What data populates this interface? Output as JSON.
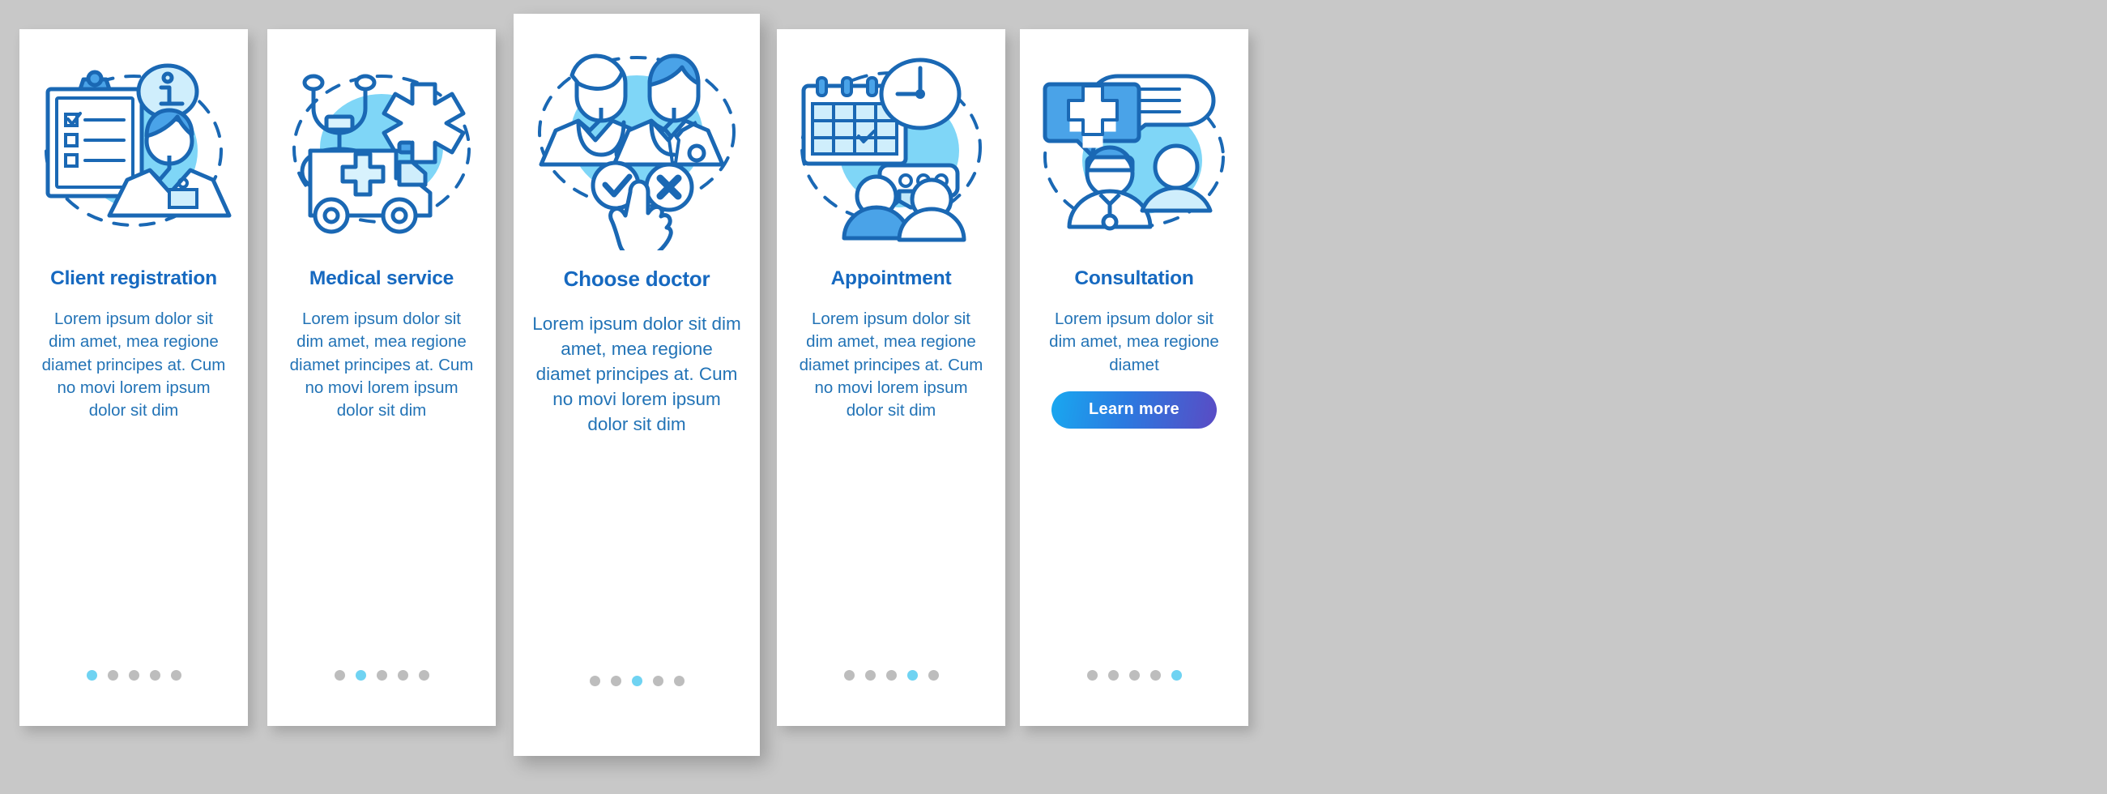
{
  "page": {
    "background_color": "#c8c8c8",
    "card_background": "#ffffff",
    "title_color": "#1669c0",
    "body_color": "#2273b6",
    "dot_active_color": "#6fd3f2",
    "dot_inactive_color": "#bdbdbd",
    "accent_light": "#7fd6f7",
    "accent_mid": "#4aa3e8",
    "accent_stroke": "#1a68b4"
  },
  "screens": [
    {
      "id": "client-registration",
      "title": "Client registration",
      "body": "Lorem ipsum dolor sit dim amet, mea regione diamet principes at. Cum no movi lorem ipsum dolor sit dim",
      "icon": "clipboard-checklist-person-info-icon",
      "dots": {
        "count": 5,
        "active_index": 0
      },
      "button": null
    },
    {
      "id": "medical-service",
      "title": "Medical service",
      "body": "Lorem ipsum dolor sit dim amet, mea regione diamet principes at. Cum no movi lorem ipsum dolor sit dim",
      "icon": "ambulance-stethoscope-star-of-life-icon",
      "dots": {
        "count": 5,
        "active_index": 1
      },
      "button": null
    },
    {
      "id": "choose-doctor",
      "title": "Choose doctor",
      "body": "Lorem ipsum dolor sit dim amet, mea regione diamet principes at. Cum no movi lorem ipsum dolor sit dim",
      "icon": "two-doctors-check-cross-pointer-icon",
      "dots": {
        "count": 5,
        "active_index": 2
      },
      "button": null
    },
    {
      "id": "appointment",
      "title": "Appointment",
      "body": "Lorem ipsum dolor sit dim amet, mea regione diamet principes at. Cum no movi lorem ipsum dolor sit dim",
      "icon": "calendar-clock-chat-people-icon",
      "dots": {
        "count": 5,
        "active_index": 3
      },
      "button": null
    },
    {
      "id": "consultation",
      "title": "Consultation",
      "body": "Lorem ipsum dolor sit dim amet, mea regione diamet",
      "icon": "chat-bubbles-doctor-patient-icon",
      "dots": {
        "count": 5,
        "active_index": 4
      },
      "button": {
        "label": "Learn more",
        "gradient_from": "#19a8f0",
        "gradient_to": "#5a4bc4"
      }
    }
  ]
}
